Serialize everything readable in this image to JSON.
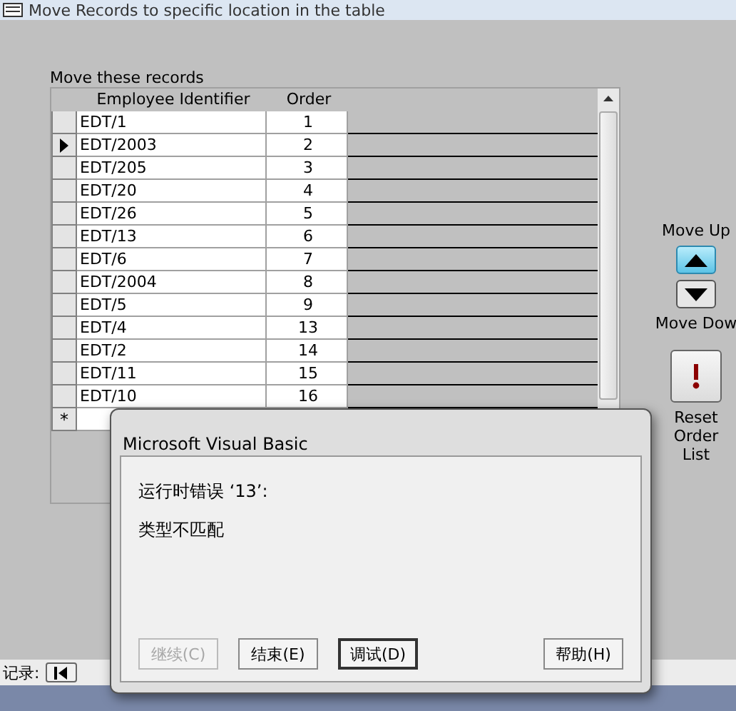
{
  "window": {
    "title": "Move Records to specific location in the table"
  },
  "datasheet": {
    "caption": "Move these records",
    "columns": [
      "Employee Identifier",
      "Order"
    ],
    "rows": [
      {
        "employee": "EDT/1",
        "order": "1",
        "selected": false
      },
      {
        "employee": "EDT/2003",
        "order": "2",
        "selected": true
      },
      {
        "employee": "EDT/205",
        "order": "3",
        "selected": false
      },
      {
        "employee": "EDT/20",
        "order": "4",
        "selected": false
      },
      {
        "employee": "EDT/26",
        "order": "5",
        "selected": false
      },
      {
        "employee": "EDT/13",
        "order": "6",
        "selected": false
      },
      {
        "employee": "EDT/6",
        "order": "7",
        "selected": false
      },
      {
        "employee": "EDT/2004",
        "order": "8",
        "selected": false
      },
      {
        "employee": "EDT/5",
        "order": "9",
        "selected": false
      },
      {
        "employee": "EDT/4",
        "order": "13",
        "selected": false
      },
      {
        "employee": "EDT/2",
        "order": "14",
        "selected": false
      },
      {
        "employee": "EDT/11",
        "order": "15",
        "selected": false
      },
      {
        "employee": "EDT/10",
        "order": "16",
        "selected": false
      }
    ],
    "new_row_marker": "*"
  },
  "controls": {
    "move_up_label": "Move Up",
    "move_up_highlighted": true,
    "move_down_label": "Move Dow",
    "move_down_highlighted": false,
    "reset_label": "Reset Order List"
  },
  "navigation": {
    "label": "记录:"
  },
  "dialog": {
    "title": "Microsoft Visual Basic",
    "message": "运行时错误 ‘13’:",
    "detail": "类型不匹配",
    "buttons": [
      {
        "label": "继续(C)",
        "disabled": true,
        "default": false
      },
      {
        "label": "结束(E)",
        "disabled": false,
        "default": false
      },
      {
        "label": "调试(D)",
        "disabled": false,
        "default": true
      },
      {
        "label": "帮助(H)",
        "disabled": false,
        "default": false
      }
    ]
  }
}
